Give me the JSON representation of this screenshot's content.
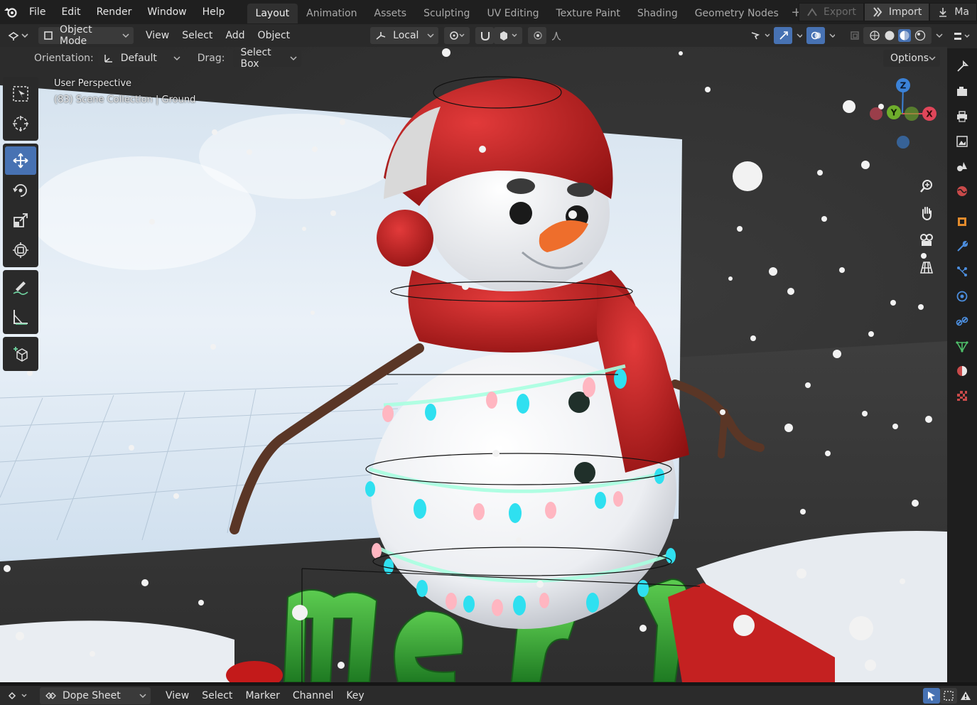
{
  "topbar": {
    "menus": [
      "File",
      "Edit",
      "Render",
      "Window",
      "Help"
    ],
    "workspaces": [
      "Layout",
      "Animation",
      "Assets",
      "Sculpting",
      "UV Editing",
      "Texture Paint",
      "Shading",
      "Geometry Nodes"
    ],
    "active_workspace": "Layout",
    "export_label": "Export",
    "import_label": "Import",
    "truncated_label": "Ma"
  },
  "header": {
    "mode": "Object Mode",
    "menus": [
      "View",
      "Select",
      "Add",
      "Object"
    ],
    "transform_orientation": "Local"
  },
  "tool_settings": {
    "orientation_label": "Orientation:",
    "orientation_value": "Default",
    "drag_label": "Drag:",
    "drag_value": "Select Box",
    "options_label": "Options"
  },
  "viewport": {
    "perspective_label": "User Perspective",
    "scene_label": "(83) Scene Collection | Ground",
    "scene_text": "merry"
  },
  "gizmo": {
    "z": "Z",
    "y": "Y",
    "x": "X"
  },
  "bottombar": {
    "editor": "Dope Sheet",
    "menus": [
      "View",
      "Select",
      "Marker",
      "Channel",
      "Key"
    ]
  },
  "colors": {
    "accent": "#4772b3",
    "x_axis": "#e0465a",
    "y_axis": "#6fae2c",
    "z_axis": "#3b82d8"
  }
}
